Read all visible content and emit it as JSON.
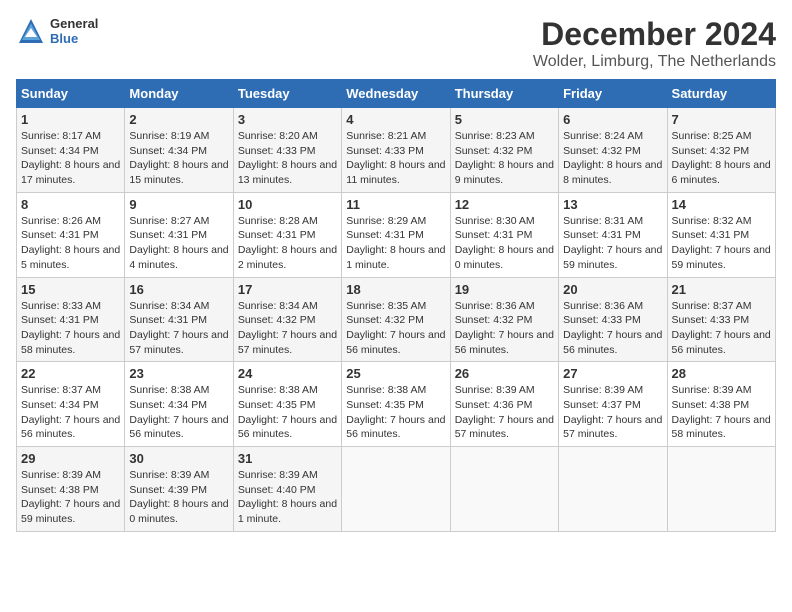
{
  "header": {
    "logo_general": "General",
    "logo_blue": "Blue",
    "month_title": "December 2024",
    "location": "Wolder, Limburg, The Netherlands"
  },
  "days_of_week": [
    "Sunday",
    "Monday",
    "Tuesday",
    "Wednesday",
    "Thursday",
    "Friday",
    "Saturday"
  ],
  "weeks": [
    [
      {
        "day": "1",
        "info": "Sunrise: 8:17 AM\nSunset: 4:34 PM\nDaylight: 8 hours and 17 minutes."
      },
      {
        "day": "2",
        "info": "Sunrise: 8:19 AM\nSunset: 4:34 PM\nDaylight: 8 hours and 15 minutes."
      },
      {
        "day": "3",
        "info": "Sunrise: 8:20 AM\nSunset: 4:33 PM\nDaylight: 8 hours and 13 minutes."
      },
      {
        "day": "4",
        "info": "Sunrise: 8:21 AM\nSunset: 4:33 PM\nDaylight: 8 hours and 11 minutes."
      },
      {
        "day": "5",
        "info": "Sunrise: 8:23 AM\nSunset: 4:32 PM\nDaylight: 8 hours and 9 minutes."
      },
      {
        "day": "6",
        "info": "Sunrise: 8:24 AM\nSunset: 4:32 PM\nDaylight: 8 hours and 8 minutes."
      },
      {
        "day": "7",
        "info": "Sunrise: 8:25 AM\nSunset: 4:32 PM\nDaylight: 8 hours and 6 minutes."
      }
    ],
    [
      {
        "day": "8",
        "info": "Sunrise: 8:26 AM\nSunset: 4:31 PM\nDaylight: 8 hours and 5 minutes."
      },
      {
        "day": "9",
        "info": "Sunrise: 8:27 AM\nSunset: 4:31 PM\nDaylight: 8 hours and 4 minutes."
      },
      {
        "day": "10",
        "info": "Sunrise: 8:28 AM\nSunset: 4:31 PM\nDaylight: 8 hours and 2 minutes."
      },
      {
        "day": "11",
        "info": "Sunrise: 8:29 AM\nSunset: 4:31 PM\nDaylight: 8 hours and 1 minute."
      },
      {
        "day": "12",
        "info": "Sunrise: 8:30 AM\nSunset: 4:31 PM\nDaylight: 8 hours and 0 minutes."
      },
      {
        "day": "13",
        "info": "Sunrise: 8:31 AM\nSunset: 4:31 PM\nDaylight: 7 hours and 59 minutes."
      },
      {
        "day": "14",
        "info": "Sunrise: 8:32 AM\nSunset: 4:31 PM\nDaylight: 7 hours and 59 minutes."
      }
    ],
    [
      {
        "day": "15",
        "info": "Sunrise: 8:33 AM\nSunset: 4:31 PM\nDaylight: 7 hours and 58 minutes."
      },
      {
        "day": "16",
        "info": "Sunrise: 8:34 AM\nSunset: 4:31 PM\nDaylight: 7 hours and 57 minutes."
      },
      {
        "day": "17",
        "info": "Sunrise: 8:34 AM\nSunset: 4:32 PM\nDaylight: 7 hours and 57 minutes."
      },
      {
        "day": "18",
        "info": "Sunrise: 8:35 AM\nSunset: 4:32 PM\nDaylight: 7 hours and 56 minutes."
      },
      {
        "day": "19",
        "info": "Sunrise: 8:36 AM\nSunset: 4:32 PM\nDaylight: 7 hours and 56 minutes."
      },
      {
        "day": "20",
        "info": "Sunrise: 8:36 AM\nSunset: 4:33 PM\nDaylight: 7 hours and 56 minutes."
      },
      {
        "day": "21",
        "info": "Sunrise: 8:37 AM\nSunset: 4:33 PM\nDaylight: 7 hours and 56 minutes."
      }
    ],
    [
      {
        "day": "22",
        "info": "Sunrise: 8:37 AM\nSunset: 4:34 PM\nDaylight: 7 hours and 56 minutes."
      },
      {
        "day": "23",
        "info": "Sunrise: 8:38 AM\nSunset: 4:34 PM\nDaylight: 7 hours and 56 minutes."
      },
      {
        "day": "24",
        "info": "Sunrise: 8:38 AM\nSunset: 4:35 PM\nDaylight: 7 hours and 56 minutes."
      },
      {
        "day": "25",
        "info": "Sunrise: 8:38 AM\nSunset: 4:35 PM\nDaylight: 7 hours and 56 minutes."
      },
      {
        "day": "26",
        "info": "Sunrise: 8:39 AM\nSunset: 4:36 PM\nDaylight: 7 hours and 57 minutes."
      },
      {
        "day": "27",
        "info": "Sunrise: 8:39 AM\nSunset: 4:37 PM\nDaylight: 7 hours and 57 minutes."
      },
      {
        "day": "28",
        "info": "Sunrise: 8:39 AM\nSunset: 4:38 PM\nDaylight: 7 hours and 58 minutes."
      }
    ],
    [
      {
        "day": "29",
        "info": "Sunrise: 8:39 AM\nSunset: 4:38 PM\nDaylight: 7 hours and 59 minutes."
      },
      {
        "day": "30",
        "info": "Sunrise: 8:39 AM\nSunset: 4:39 PM\nDaylight: 8 hours and 0 minutes."
      },
      {
        "day": "31",
        "info": "Sunrise: 8:39 AM\nSunset: 4:40 PM\nDaylight: 8 hours and 1 minute."
      },
      null,
      null,
      null,
      null
    ]
  ]
}
